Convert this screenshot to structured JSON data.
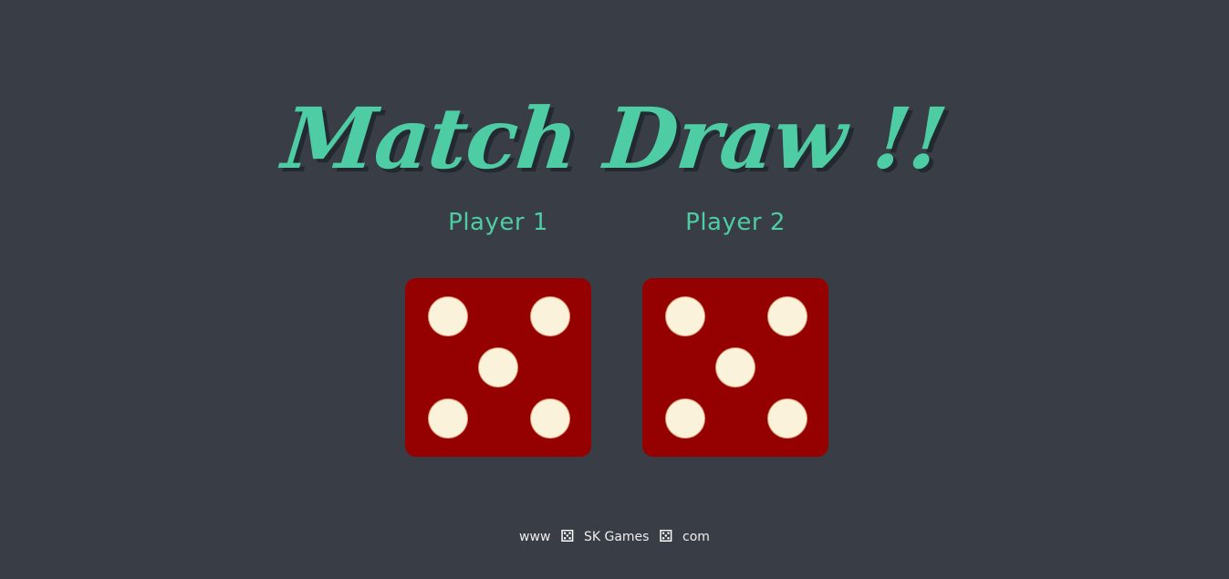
{
  "title": "Match Draw !!",
  "players": [
    {
      "label": "Player 1",
      "die_value": 5
    },
    {
      "label": "Player 2",
      "die_value": 5
    }
  ],
  "footer": {
    "prefix": "www",
    "name": "SK Games",
    "suffix": "com",
    "icon": "die-icon"
  },
  "colors": {
    "background": "#393e46",
    "accent": "#4ecca3",
    "die": "#950101",
    "pip": "#fbf2dc"
  }
}
